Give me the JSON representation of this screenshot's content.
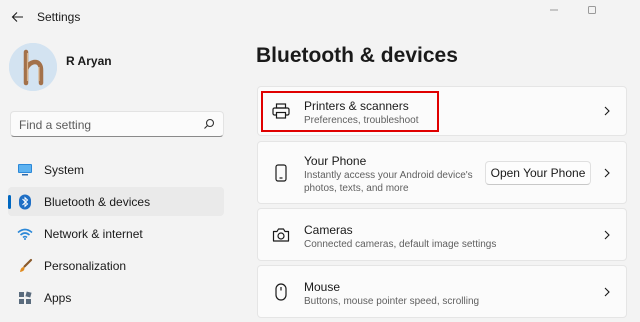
{
  "window": {
    "title": "Settings",
    "controls": [
      "minimize-icon",
      "maximize-icon"
    ]
  },
  "user": {
    "name": "R Aryan",
    "avatar_letter": "h"
  },
  "search": {
    "placeholder": "Find a setting"
  },
  "sidebar": {
    "items": [
      {
        "label": "System",
        "icon": "monitor-icon",
        "active": false
      },
      {
        "label": "Bluetooth & devices",
        "icon": "bluetooth-icon",
        "active": true
      },
      {
        "label": "Network & internet",
        "icon": "wifi-icon",
        "active": false
      },
      {
        "label": "Personalization",
        "icon": "brush-icon",
        "active": false
      },
      {
        "label": "Apps",
        "icon": "apps-icon",
        "active": false
      }
    ]
  },
  "main": {
    "title": "Bluetooth & devices",
    "cards": [
      {
        "title": "Printers & scanners",
        "subtitle": "Preferences, troubleshoot",
        "icon": "printer-icon",
        "highlighted": true
      },
      {
        "title": "Your Phone",
        "subtitle": "Instantly access your Android device's photos, texts, and more",
        "icon": "phone-icon",
        "button": "Open Your Phone"
      },
      {
        "title": "Cameras",
        "subtitle": "Connected cameras, default image settings",
        "icon": "camera-icon"
      },
      {
        "title": "Mouse",
        "subtitle": "Buttons, mouse pointer speed, scrolling",
        "icon": "mouse-icon"
      }
    ]
  },
  "colors": {
    "accent": "#0067c0",
    "highlight_box": "#e00000",
    "background": "#f3f3f3",
    "card": "#fbfbfb"
  }
}
